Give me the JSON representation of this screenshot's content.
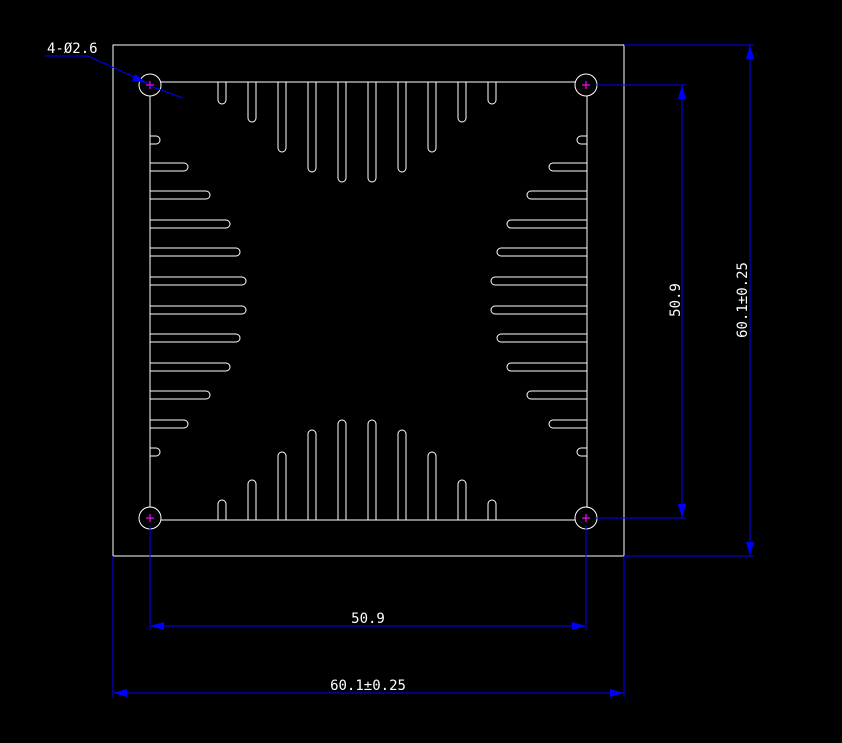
{
  "drawing": {
    "background": "#000000",
    "colors": {
      "outline": "#ffffff",
      "dimension": "#0000ff",
      "dimension_text": "#ffffff",
      "hole_marker": "#ff00ff"
    },
    "annotations": {
      "hole_callout": "4-Ø2.6",
      "hole_spacing_horizontal": "50.9",
      "overall_width": "60.1±0.25",
      "hole_spacing_vertical": "50.9",
      "overall_height": "60.1±0.25"
    },
    "holes": {
      "count": 4,
      "diameter": 2.6,
      "spacing_mm": 50.9
    },
    "outline": {
      "size_mm": 60.1,
      "tolerance_mm": 0.25
    },
    "fins": {
      "top_count": 10,
      "bottom_count": 10,
      "left_count": 12,
      "right_count": 12
    },
    "icons": [
      "crosshair-icon"
    ]
  }
}
